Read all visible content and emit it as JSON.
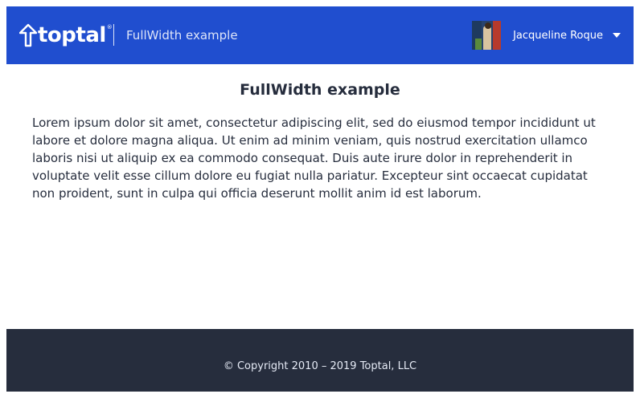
{
  "header": {
    "logo_text": "toptal",
    "logo_reg": "®",
    "title": "FullWidth example",
    "user": {
      "name": "Jacqueline Roque"
    }
  },
  "main": {
    "title": "FullWidth example",
    "paragraph": "Lorem ipsum dolor sit amet, consectetur adipiscing elit, sed do eiusmod tempor incididunt ut labore et dolore magna aliqua. Ut enim ad minim veniam, quis nostrud exercitation ullamco laboris nisi ut aliquip ex ea commodo consequat. Duis aute irure dolor in reprehenderit in voluptate velit esse cillum dolore eu fugiat nulla pariatur. Excepteur sint occaecat cupidatat non proident, sunt in culpa qui officia deserunt mollit anim id est laborum."
  },
  "footer": {
    "copyright": "© Copyright 2010 – 2019 Toptal, LLC"
  },
  "colors": {
    "header_bg": "#204ecf",
    "footer_bg": "#262d3d",
    "text": "#262d3d"
  },
  "icons": {
    "logo": "toptal-logo-icon",
    "caret": "chevron-down-icon"
  }
}
